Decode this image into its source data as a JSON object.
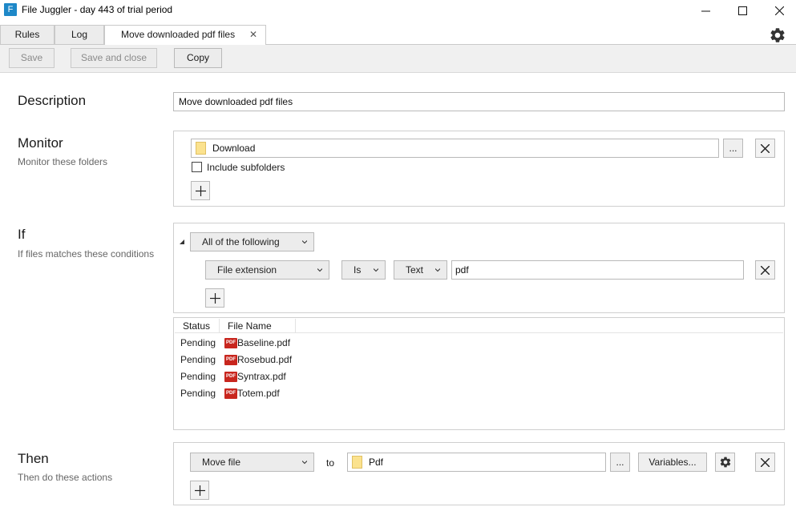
{
  "window": {
    "app_icon_letter": "F",
    "title": "File Juggler - day 443 of trial period",
    "min_glyph": "—",
    "max_glyph": "☐",
    "close_glyph": "✕"
  },
  "tabs": [
    {
      "label": "Rules"
    },
    {
      "label": "Log"
    },
    {
      "label": "Move downloaded pdf files",
      "close_glyph": "✕"
    }
  ],
  "toolbar": {
    "save_label": "Save",
    "save_close_label": "Save and close",
    "copy_label": "Copy"
  },
  "description": {
    "title": "Description",
    "value": "Move downloaded pdf files"
  },
  "monitor": {
    "title": "Monitor",
    "subtitle": "Monitor these folders",
    "folder": "Download",
    "browse_label": "...",
    "include_subfolders_label": "Include subfolders",
    "include_subfolders_checked": false,
    "add_glyph": "+"
  },
  "conditions": {
    "title": "If",
    "subtitle": "If files matches these conditions",
    "group_operator": "All of the following",
    "condition": {
      "property": "File extension",
      "operator": "Is",
      "type": "Text",
      "value": "pdf"
    },
    "add_glyph": "+"
  },
  "files_table": {
    "columns": [
      "Status",
      "File Name"
    ],
    "pdf_badge": "PDF",
    "rows": [
      {
        "status": "Pending",
        "file": "Baseline.pdf"
      },
      {
        "status": "Pending",
        "file": "Rosebud.pdf"
      },
      {
        "status": "Pending",
        "file": "Syntrax.pdf"
      },
      {
        "status": "Pending",
        "file": "Totem.pdf"
      }
    ]
  },
  "actions": {
    "title": "Then",
    "subtitle": "Then do these actions",
    "action": "Move file",
    "to_label": "to",
    "target_folder": "Pdf",
    "browse_label": "...",
    "variables_label": "Variables...",
    "add_glyph": "+"
  },
  "colors": {
    "accent": "#1e88c8",
    "folder": "#fbe28e",
    "pdf_red": "#c8261e"
  }
}
